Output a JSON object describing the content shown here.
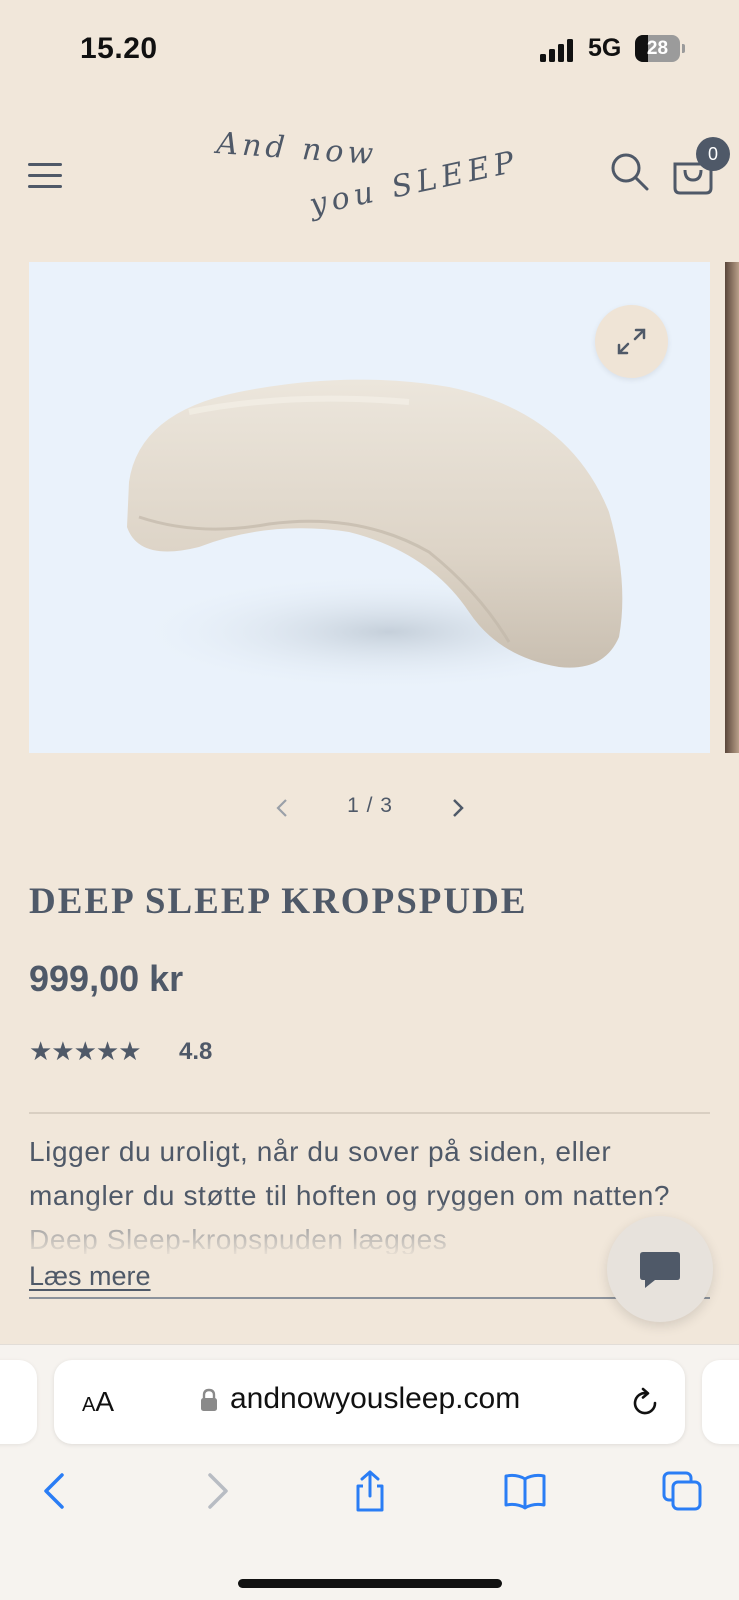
{
  "status_bar": {
    "time": "15.20",
    "network": "5G",
    "battery": "28",
    "battery_level": 0.28
  },
  "header": {
    "logo_text": [
      "And now",
      "you SLEEP"
    ],
    "cart_count": "0"
  },
  "gallery": {
    "image_alt": "",
    "pager_text": "1 / 3"
  },
  "product": {
    "title": "DEEP SLEEP KROPSPUDE",
    "price": "999,00 kr",
    "stars": "★★★★★",
    "rating": 4.8,
    "rating_text": "4.8",
    "description": "Ligger du uroligt, når du sover på siden, eller mangler du støtte til hoften og ryggen om natten? Deep Sleep-kropspuden lægges",
    "read_more": "Læs mere"
  },
  "browser": {
    "aa_small": "A",
    "aa_large": "A",
    "url": "andnowyousleep.com"
  },
  "colors": {
    "background": "#f1e7da",
    "text": "#4f5968",
    "link_blue": "#2a7df5"
  },
  "icons": [
    "hamburger-icon",
    "search-icon",
    "cart-icon",
    "expand-icon",
    "chevron-left-icon",
    "chevron-right-icon",
    "chat-icon",
    "lock-icon",
    "reload-icon",
    "back-icon",
    "forward-icon",
    "share-icon",
    "bookmarks-icon",
    "tabs-icon"
  ]
}
